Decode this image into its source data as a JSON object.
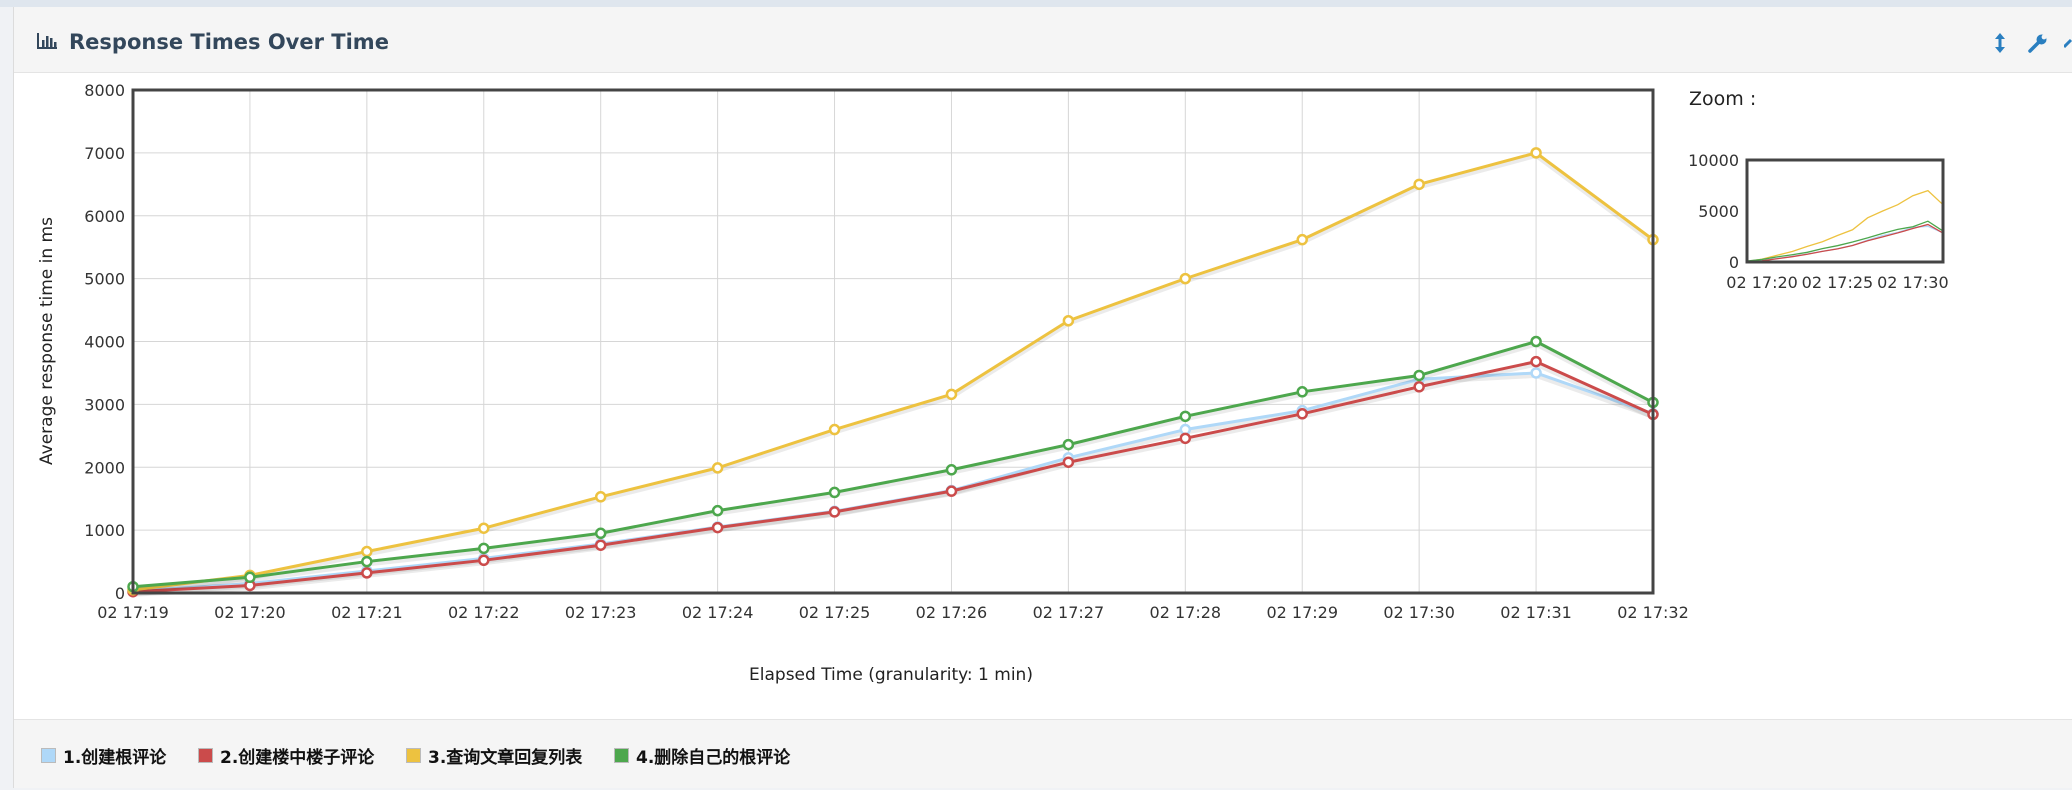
{
  "panel": {
    "title": "Response Times Over Time",
    "title_icon": "bar-chart-icon",
    "tools": [
      "vertical-resize-icon",
      "wrench-icon",
      "collapse-icon"
    ]
  },
  "chart_data": {
    "type": "line",
    "title": "",
    "xlabel": "Elapsed Time (granularity: 1 min)",
    "ylabel": "Average response time in ms",
    "ylim": [
      0,
      8000
    ],
    "yticks": [
      0,
      1000,
      2000,
      3000,
      4000,
      5000,
      6000,
      7000,
      8000
    ],
    "categories": [
      "02 17:19",
      "02 17:20",
      "02 17:21",
      "02 17:22",
      "02 17:23",
      "02 17:24",
      "02 17:25",
      "02 17:26",
      "02 17:27",
      "02 17:28",
      "02 17:29",
      "02 17:30",
      "02 17:31",
      "02 17:32"
    ],
    "grid": true,
    "legend_position": "bottom",
    "series": [
      {
        "name": "1.创建根评论",
        "color": "#afd8f8",
        "values": [
          30,
          150,
          350,
          550,
          780,
          1050,
          1300,
          1630,
          2150,
          2600,
          2900,
          3400,
          3500,
          2850
        ]
      },
      {
        "name": "2.创建楼中楼子评论",
        "color": "#cb4b4b",
        "values": [
          20,
          120,
          320,
          520,
          760,
          1040,
          1290,
          1620,
          2080,
          2460,
          2850,
          3280,
          3680,
          2840
        ]
      },
      {
        "name": "3.查询文章回复列表",
        "color": "#edc240",
        "values": [
          50,
          280,
          660,
          1030,
          1530,
          1990,
          2600,
          3160,
          4330,
          5000,
          5620,
          6500,
          7000,
          5620
        ]
      },
      {
        "name": "4.删除自己的根评论",
        "color": "#4da74d",
        "values": [
          100,
          250,
          500,
          710,
          950,
          1310,
          1600,
          1960,
          2360,
          2810,
          3200,
          3460,
          4000,
          3030
        ]
      }
    ]
  },
  "zoom": {
    "label": "Zoom :",
    "yticks": [
      "10000",
      "5000",
      "0"
    ],
    "xticks": [
      "02 17:20",
      "02 17:25",
      "02 17:30"
    ],
    "ylim": [
      0,
      10000
    ]
  }
}
